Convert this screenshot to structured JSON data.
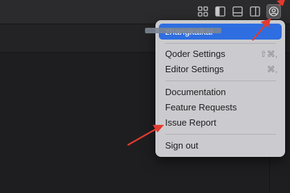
{
  "titlebar": {
    "icons": [
      "layout-grid-icon",
      "toggle-primary-sidebar-icon",
      "toggle-panel-icon",
      "toggle-secondary-sidebar-icon",
      "account-icon"
    ]
  },
  "account_menu": {
    "username": "zhangkaikai",
    "sections": [
      {
        "label": "Qoder Settings",
        "shortcut": "⇧⌘,"
      },
      {
        "label": "Editor Settings",
        "shortcut": "⌘,"
      },
      {
        "label": "Documentation",
        "shortcut": ""
      },
      {
        "label": "Feature Requests",
        "shortcut": ""
      },
      {
        "label": "Issue Report",
        "shortcut": ""
      },
      {
        "label": "Sign out",
        "shortcut": ""
      }
    ]
  },
  "colors": {
    "highlight": "#2f6ee0",
    "annotation_arrow": "#e23b2e"
  }
}
